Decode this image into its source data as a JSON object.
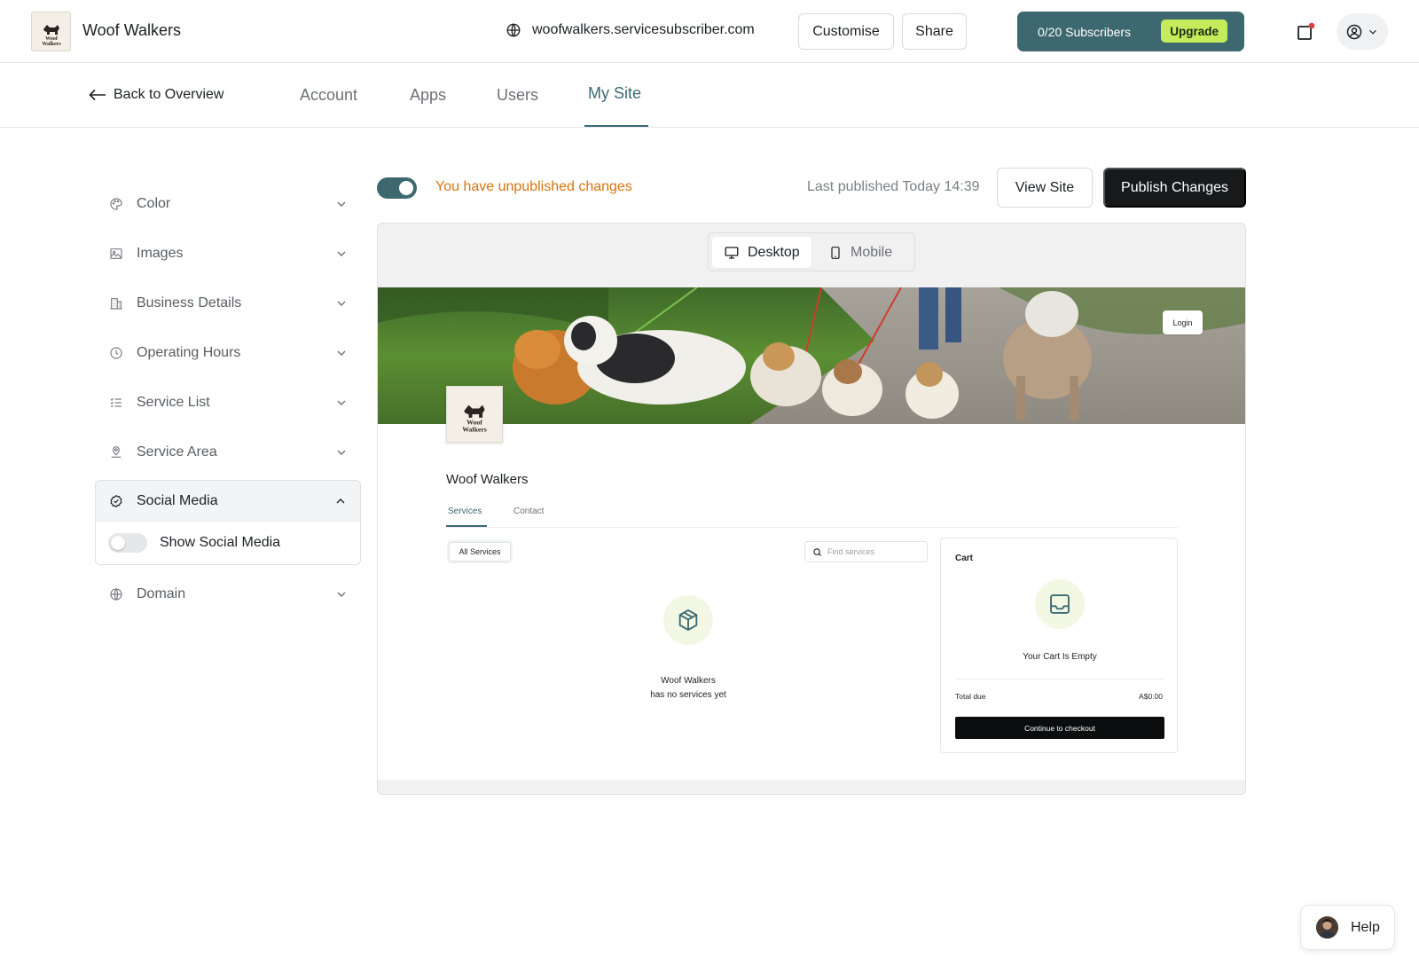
{
  "header": {
    "brand_name": "Woof Walkers",
    "logo_text_line1": "Woof",
    "logo_text_line2": "Walkers",
    "domain": "woofwalkers.servicesubscriber.com",
    "customise_label": "Customise",
    "share_label": "Share",
    "subscribers": "0/20 Subscribers",
    "upgrade_label": "Upgrade",
    "accent_color": "#3d6870",
    "upgrade_color": "#c4ec5a"
  },
  "nav": {
    "back_label": "Back to Overview",
    "tabs": [
      {
        "label": "Account"
      },
      {
        "label": "Apps"
      },
      {
        "label": "Users"
      },
      {
        "label": "My Site"
      }
    ],
    "active_tab": "My Site"
  },
  "sidebar": {
    "items": [
      {
        "label": "Color",
        "icon": "palette-icon"
      },
      {
        "label": "Images",
        "icon": "image-icon"
      },
      {
        "label": "Business Details",
        "icon": "building-icon"
      },
      {
        "label": "Operating Hours",
        "icon": "clock-icon"
      },
      {
        "label": "Service List",
        "icon": "list-icon"
      },
      {
        "label": "Service Area",
        "icon": "map-pin-icon"
      },
      {
        "label": "Social Media",
        "icon": "badge-check-icon",
        "expanded": true
      },
      {
        "label": "Domain",
        "icon": "globe-icon"
      }
    ],
    "social_toggle_label": "Show Social Media",
    "social_toggle_on": false
  },
  "status": {
    "unpublished_text": "You have unpublished changes",
    "last_published": "Last published Today 14:39",
    "view_site_label": "View Site",
    "publish_label": "Publish Changes",
    "warning_color": "#d9730d"
  },
  "preview": {
    "device_options": [
      "Desktop",
      "Mobile"
    ],
    "selected_device": "Desktop",
    "site": {
      "login_label": "Login",
      "business_name": "Woof Walkers",
      "tabs": [
        "Services",
        "Contact"
      ],
      "active_tab": "Services",
      "filter_label": "All Services",
      "search_placeholder": "Find services",
      "empty_line1": "Woof Walkers",
      "empty_line2": "has no services yet",
      "cart": {
        "title": "Cart",
        "empty_text": "Your Cart Is Empty",
        "total_label": "Total due",
        "total_value": "A$0.00",
        "checkout_label": "Continue to checkout"
      }
    }
  },
  "help": {
    "label": "Help"
  }
}
